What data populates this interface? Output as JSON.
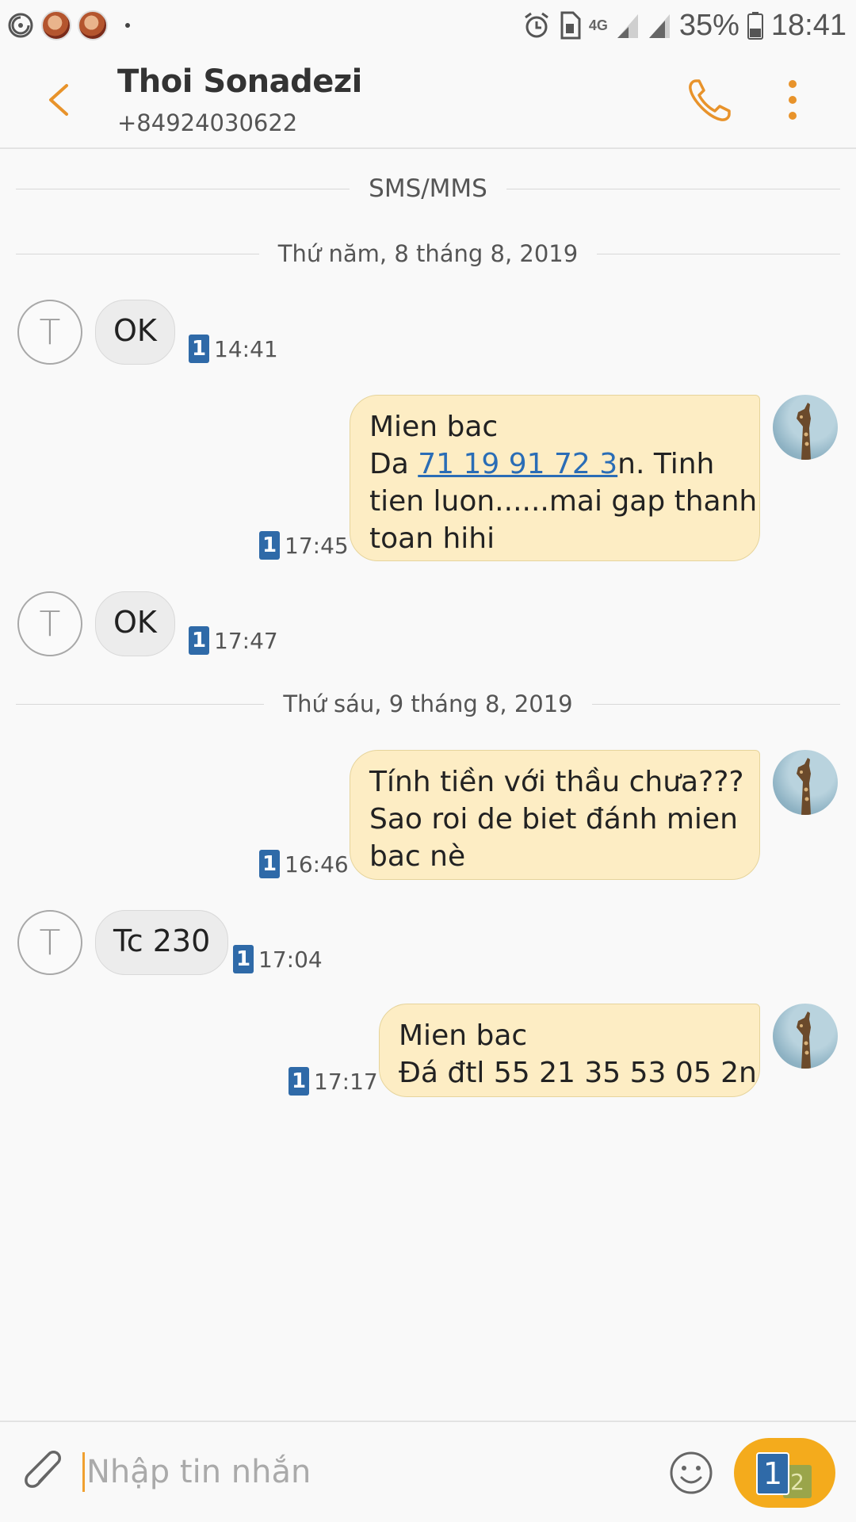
{
  "status_bar": {
    "battery": "35%",
    "time": "18:41",
    "network": "4G"
  },
  "header": {
    "contact_name": "Thoi Sonadezi",
    "contact_number": "+84924030622"
  },
  "conversation": {
    "channel_label": "SMS/MMS",
    "dates": [
      "Thứ năm, 8 tháng 8, 2019",
      "Thứ sáu, 9 tháng 8, 2019"
    ],
    "messages": [
      {
        "direction": "incoming",
        "text": "OK",
        "sim": "1",
        "time": "14:41"
      },
      {
        "direction": "outgoing",
        "lines": [
          "Mien bac",
          "Da ",
          "71 19 91 72 3",
          "n. Tinh",
          "tien luon......mai gap thanh",
          "toan hihi"
        ],
        "sim": "1",
        "time": "17:45"
      },
      {
        "direction": "incoming",
        "text": "OK",
        "sim": "1",
        "time": "17:47"
      },
      {
        "direction": "outgoing",
        "lines": [
          "Tính tiền với thầu chưa???",
          "Sao roi de biet đánh mien",
          "bac nè"
        ],
        "sim": "1",
        "time": "16:46"
      },
      {
        "direction": "incoming",
        "text": "Tc 230",
        "sim": "1",
        "time": "17:04"
      },
      {
        "direction": "outgoing",
        "lines": [
          "Mien bac",
          "Đá  đtl 55 21 35 53 05 2n"
        ],
        "sim": "1",
        "time": "17:17"
      }
    ],
    "avatar_letter": "T"
  },
  "composer": {
    "placeholder": "Nhập tin nhắn",
    "send_sim_primary": "1",
    "send_sim_secondary": "2"
  },
  "colors": {
    "accent": "#e8932b",
    "incoming_bubble": "#ececec",
    "outgoing_bubble": "#fdedc4",
    "sim_badge": "#2f6aa8",
    "send_button": "#f4ab1c"
  }
}
